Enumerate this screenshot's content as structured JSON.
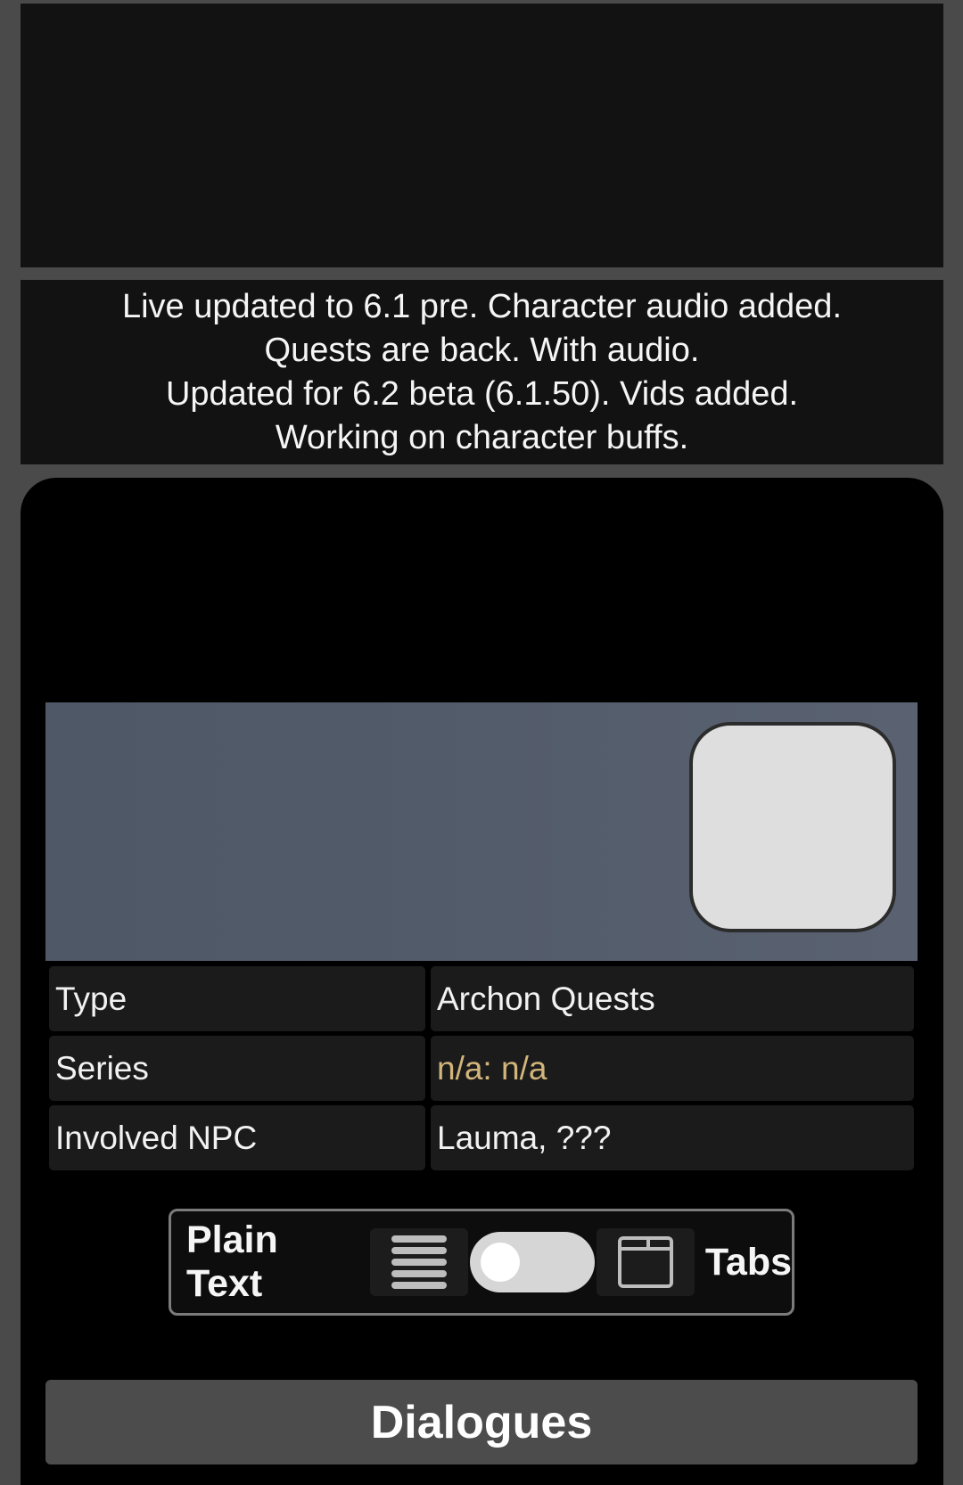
{
  "notice": {
    "lines": [
      "Live updated to 6.1 pre. Character audio added.",
      "Quests are back. With audio.",
      "Updated for 6.2 beta (6.1.50). Vids added.",
      "Working on character buffs."
    ]
  },
  "info": {
    "rows": [
      {
        "label": "Type",
        "value": "Archon Quests"
      },
      {
        "label": "Series",
        "value": "n/a: n/a"
      },
      {
        "label": "Involved NPC",
        "value": "Lauma, ???"
      }
    ]
  },
  "view_toggle": {
    "left_label": "Plain Text",
    "right_label": "Tabs",
    "left_icon": "lines-icon",
    "right_icon": "window-icon",
    "state": "plain-text"
  },
  "dialogues_label": "Dialogues",
  "colors": {
    "page_bg": "#4a4a4a",
    "panel_bg": "#121212",
    "card_bg": "#000000",
    "link": "#d1b57a",
    "switch_track": "#d6d6d6"
  }
}
